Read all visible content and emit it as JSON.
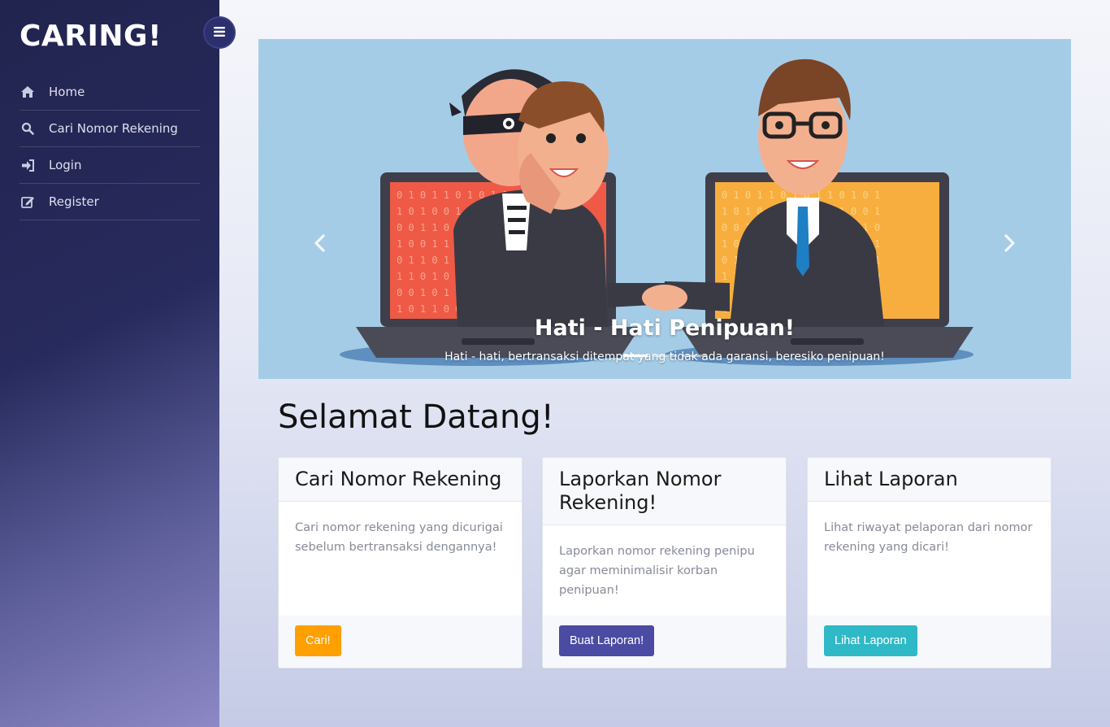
{
  "sidebar": {
    "brand": "CARING!",
    "toggle_icon": "bars-icon",
    "items": [
      {
        "label": "Home",
        "icon": "home-icon"
      },
      {
        "label": "Cari Nomor Rekening",
        "icon": "search-icon"
      },
      {
        "label": "Login",
        "icon": "sign-in-icon"
      },
      {
        "label": "Register",
        "icon": "edit-icon"
      }
    ]
  },
  "carousel": {
    "title": "Hati - Hati Penipuan!",
    "subtitle": "Hati - hati, bertransaksi ditempat yang tidak ada garansi, beresiko penipuan!",
    "prev_icon": "chevron-left-icon",
    "next_icon": "chevron-right-icon",
    "active_slide": 1,
    "slide_count": 3
  },
  "main": {
    "heading": "Selamat Datang!",
    "cards": [
      {
        "title": "Cari Nomor Rekening",
        "text": "Cari nomor rekening yang dicurigai sebelum bertransaksi dengannya!",
        "button": "Cari!",
        "button_color": "#ff9f00"
      },
      {
        "title": "Laporkan Nomor Rekening!",
        "text": "Laporkan nomor rekening penipu agar meminimalisir korban penipuan!",
        "button": "Buat Laporan!",
        "button_color": "#4b4ba3"
      },
      {
        "title": "Lihat Laporan",
        "text": "Lihat riwayat pelaporan dari nomor rekening yang dicari!",
        "button": "Lihat Laporan",
        "button_color": "#2fb8c6"
      }
    ]
  },
  "colors": {
    "sidebar_dark": "#22244f",
    "sidebar_light": "#8d88c6",
    "carousel_bg": "#a5cce6"
  }
}
